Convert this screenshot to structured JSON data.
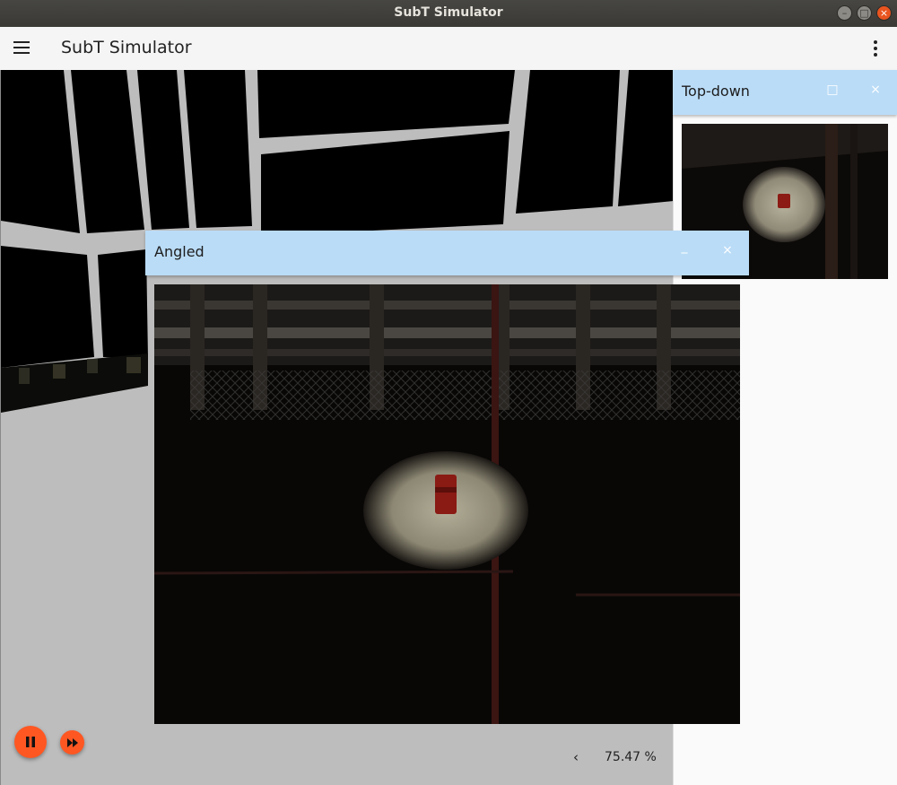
{
  "window": {
    "title": "SubT Simulator",
    "buttons": {
      "minimize": "–",
      "maximize": "□",
      "close": "×"
    }
  },
  "toolbar": {
    "title": "SubT Simulator",
    "menu_icon": "hamburger-menu-icon",
    "more_icon": "more-vertical-icon"
  },
  "plugins": {
    "topdown": {
      "title": "Top-down",
      "max_glyph": "□",
      "close_glyph": "×"
    },
    "angled": {
      "title": "Angled",
      "min_glyph": "_",
      "close_glyph": "×"
    }
  },
  "playback": {
    "play_icon": "pause-icon",
    "step_icon": "fast-forward-icon",
    "expand_glyph": "‹",
    "real_time_factor": "75.47 %"
  },
  "colors": {
    "accent": "#ff5722",
    "plugin_header": "#badcf7",
    "scene_background": "#bdbdbd"
  }
}
